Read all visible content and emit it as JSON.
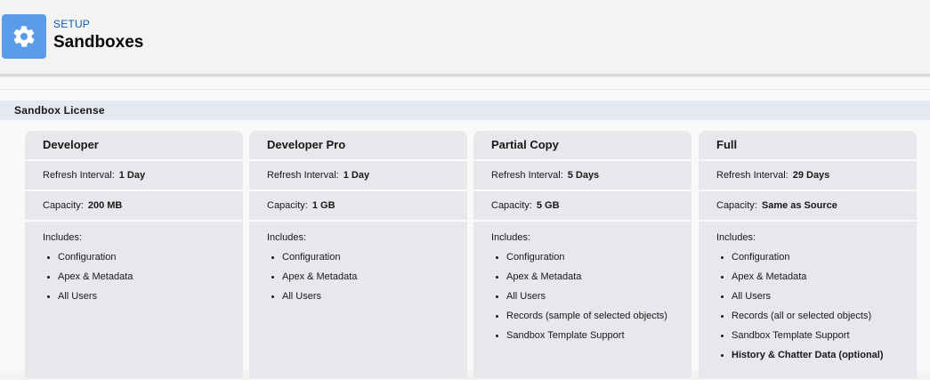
{
  "header": {
    "breadcrumb": "SETUP",
    "title": "Sandboxes",
    "icon": "gear-icon",
    "icon_color": "#5a9bea"
  },
  "section": {
    "title": "Sandbox License"
  },
  "labels": {
    "refresh": "Refresh Interval:",
    "capacity": "Capacity:",
    "includes": "Includes:"
  },
  "cards": [
    {
      "name": "Developer",
      "refresh_value": "1 Day",
      "capacity_value": "200 MB",
      "includes": [
        "Configuration",
        "Apex & Metadata",
        "All Users"
      ]
    },
    {
      "name": "Developer Pro",
      "refresh_value": "1 Day",
      "capacity_value": "1 GB",
      "includes": [
        "Configuration",
        "Apex & Metadata",
        "All Users"
      ]
    },
    {
      "name": "Partial Copy",
      "refresh_value": "5 Days",
      "capacity_value": "5 GB",
      "includes": [
        "Configuration",
        "Apex & Metadata",
        "All Users",
        "Records (sample of selected objects)",
        "Sandbox Template Support"
      ]
    },
    {
      "name": "Full",
      "refresh_value": "29 Days",
      "capacity_value": "Same as Source",
      "includes": [
        "Configuration",
        "Apex & Metadata",
        "All Users",
        "Records (all or selected objects)",
        "Sandbox Template Support",
        "History & Chatter Data (optional)"
      ]
    }
  ],
  "colors": {
    "card_bg": "#e7e8ec",
    "section_bg": "#e5e8f0",
    "breadcrumb": "#0b5cab"
  }
}
